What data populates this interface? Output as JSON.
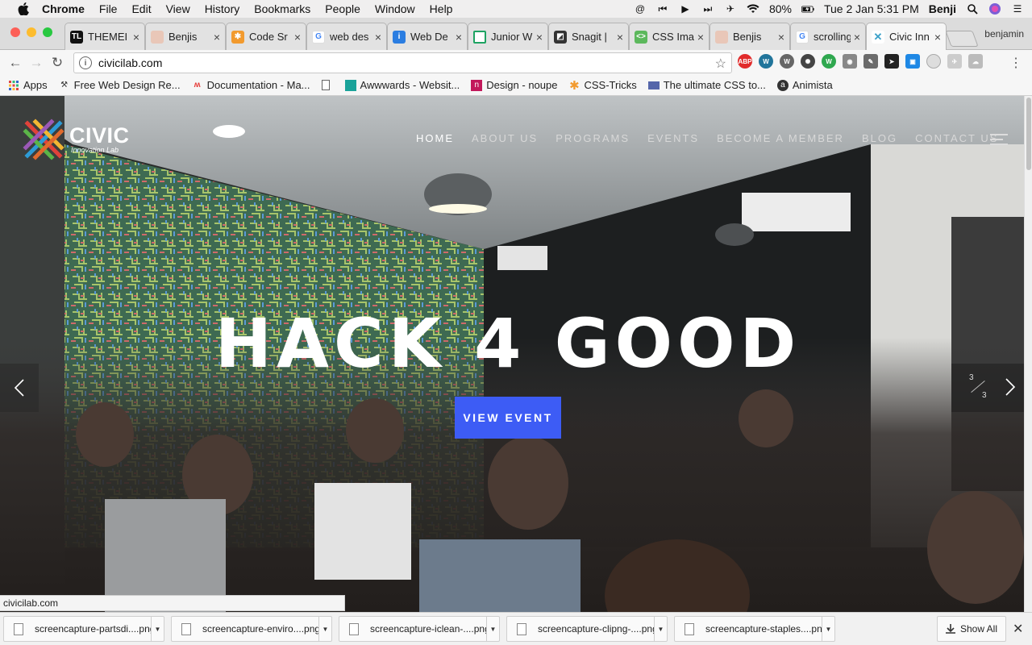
{
  "menubar": {
    "items": [
      "Chrome",
      "File",
      "Edit",
      "View",
      "History",
      "Bookmarks",
      "People",
      "Window",
      "Help"
    ],
    "battery": "80%",
    "clock": "Tue 2 Jan  5:31 PM",
    "user": "Benji"
  },
  "tabs": [
    {
      "title": "THEMEI",
      "favicon_color": "#111",
      "favicon_text": "TL"
    },
    {
      "title": "Benjis",
      "favicon_color": "#e9c7b8",
      "favicon_text": ""
    },
    {
      "title": "Code Sr",
      "favicon_color": "#f29a2e",
      "favicon_text": "✱"
    },
    {
      "title": "web des",
      "favicon_color": "#ffffff",
      "favicon_text": "G"
    },
    {
      "title": "Web De",
      "favicon_color": "#2a7de1",
      "favicon_text": "i"
    },
    {
      "title": "Junior W",
      "favicon_color": "#1ea362",
      "favicon_text": ""
    },
    {
      "title": "Snagit |",
      "favicon_color": "#333",
      "favicon_text": "◩"
    },
    {
      "title": "CSS Ima",
      "favicon_color": "#5cb85c",
      "favicon_text": "<>"
    },
    {
      "title": "Benjis",
      "favicon_color": "#e9c7b8",
      "favicon_text": ""
    },
    {
      "title": "scrolling",
      "favicon_color": "#ffffff",
      "favicon_text": "G"
    },
    {
      "title": "Civic Inn",
      "favicon_color": "#3aa0c8",
      "favicon_text": "✕"
    }
  ],
  "profile": "benjamin",
  "address": "civicilab.com",
  "bookmarks": [
    {
      "label": "Apps",
      "icon": "apps-grid-icon"
    },
    {
      "label": "Free Web Design Re...",
      "icon": "webdesign-icon"
    },
    {
      "label": "Documentation - Ma...",
      "icon": "materialize-icon"
    },
    {
      "label": "",
      "icon": "page-icon"
    },
    {
      "label": "Awwwards - Websit...",
      "icon": "awwwards-icon"
    },
    {
      "label": "Design - noupe",
      "icon": "noupe-icon"
    },
    {
      "label": "CSS-Tricks",
      "icon": "csstricks-icon"
    },
    {
      "label": "The ultimate CSS to...",
      "icon": "css-tool-icon"
    },
    {
      "label": "Animista",
      "icon": "animista-icon"
    }
  ],
  "site": {
    "logo_main": "CIVIC",
    "logo_sub": "Innovation Lab",
    "nav": [
      "HOME",
      "ABOUT US",
      "PROGRAMS",
      "EVENTS",
      "BECOME A MEMBER",
      "BLOG",
      "CONTACT US"
    ],
    "headline": "HACK 4 GOOD",
    "cta": "VIEW EVENT",
    "slider_current": "3",
    "slider_total": "3",
    "accent_color": "#3d5cf5"
  },
  "status_url": "civicilab.com",
  "downloads": [
    "screencapture-partsdi....png",
    "screencapture-enviro....png",
    "screencapture-iclean-....png",
    "screencapture-clipng-....png",
    "screencapture-staples....png"
  ],
  "show_all": "Show All"
}
